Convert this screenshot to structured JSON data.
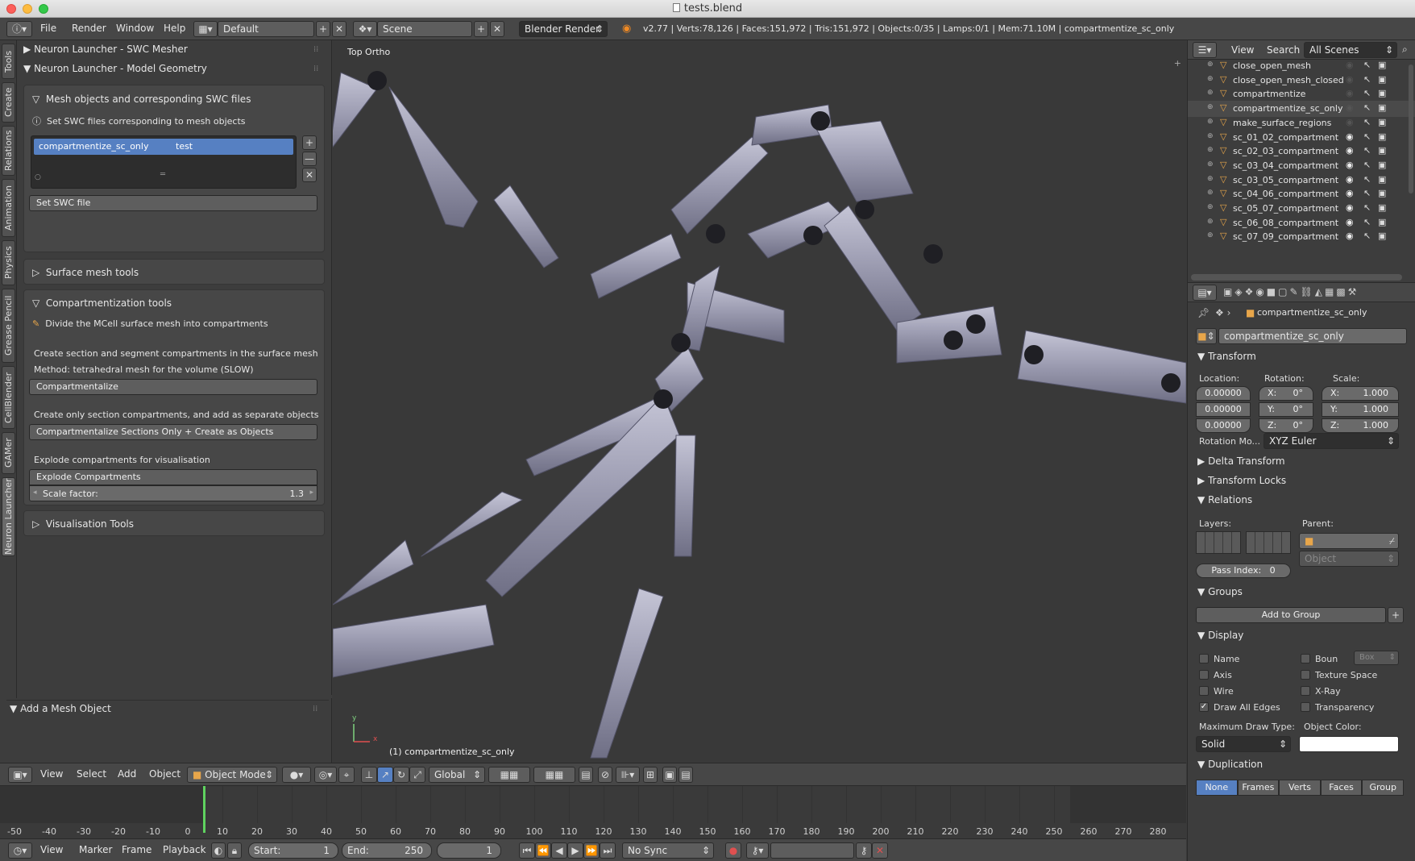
{
  "window": {
    "title": "tests.blend"
  },
  "infobar": {
    "menus": [
      "File",
      "Render",
      "Window",
      "Help"
    ],
    "layout": "Default",
    "scene": "Scene",
    "engine": "Blender Render",
    "stats": "v2.77 | Verts:78,126 | Faces:151,972 | Tris:151,972 | Objects:0/35 | Lamps:0/1 | Mem:71.10M | compartmentize_sc_only"
  },
  "vtabs": [
    "Tools",
    "Create",
    "Relations",
    "Animation",
    "Physics",
    "Grease Pencil",
    "CellBlender",
    "GAMer",
    "Neuron Launcher"
  ],
  "toolshelf": {
    "panel1": "Neuron Launcher - SWC Mesher",
    "panel2": "Neuron Launcher - Model Geometry",
    "mesh_section": "Mesh objects and corresponding SWC files",
    "set_swc_hint": "Set SWC files corresponding to mesh objects",
    "list_item_name": "compartmentize_sc_only",
    "list_item_value": "test",
    "set_swc_button": "Set SWC file",
    "surface_tools": "Surface mesh tools",
    "comp_tools": "Compartmentization tools",
    "comp_hint": "Divide the MCell surface mesh into compartments",
    "comp_text1": "Create section and segment compartments in the surface mesh",
    "comp_text2": "Method: tetrahedral mesh for the volume (SLOW)",
    "compartmentalize_button": "Compartmentalize",
    "comp_text3": "Create only section compartments, and add as separate objects",
    "sections_button": "Compartmentalize Sections Only + Create as Objects",
    "explode_text": "Explode compartments for visualisation",
    "explode_button": "Explode Compartments",
    "scale_label": "Scale factor:",
    "scale_value": "1.3",
    "vis_tools": "Visualisation Tools",
    "operator_panel": "Add a Mesh Object"
  },
  "viewport": {
    "view_name": "Top Ortho",
    "object_label": "(1) compartmentize_sc_only",
    "axis_y": "y",
    "axis_x": "x"
  },
  "viewport_header": {
    "menus": [
      "View",
      "Select",
      "Add",
      "Object"
    ],
    "mode": "Object Mode",
    "orientation": "Global"
  },
  "timeline": {
    "ticks": [
      "-50",
      "-40",
      "-30",
      "-20",
      "-10",
      "0",
      "10",
      "20",
      "30",
      "40",
      "50",
      "60",
      "70",
      "80",
      "90",
      "100",
      "110",
      "120",
      "130",
      "140",
      "150",
      "160",
      "170",
      "180",
      "190",
      "200",
      "210",
      "220",
      "230",
      "240",
      "250",
      "260",
      "270",
      "280"
    ],
    "menus": [
      "View",
      "Marker",
      "Frame",
      "Playback"
    ],
    "start_label": "Start:",
    "start_value": "1",
    "end_label": "End:",
    "end_value": "250",
    "current_frame": "1",
    "sync": "No Sync"
  },
  "outliner": {
    "menus": [
      "View",
      "Search"
    ],
    "filter": "All Scenes",
    "items": [
      {
        "name": "close_open_mesh",
        "visible": false
      },
      {
        "name": "close_open_mesh_closed",
        "visible": false
      },
      {
        "name": "compartmentize",
        "visible": false
      },
      {
        "name": "compartmentize_sc_only",
        "visible": false
      },
      {
        "name": "make_surface_regions",
        "visible": false
      },
      {
        "name": "sc_01_02_compartment",
        "visible": true
      },
      {
        "name": "sc_02_03_compartment",
        "visible": true
      },
      {
        "name": "sc_03_04_compartment",
        "visible": true
      },
      {
        "name": "sc_03_05_compartment",
        "visible": true
      },
      {
        "name": "sc_04_06_compartment",
        "visible": true
      },
      {
        "name": "sc_05_07_compartment",
        "visible": true
      },
      {
        "name": "sc_06_08_compartment",
        "visible": true
      },
      {
        "name": "sc_07_09_compartment",
        "visible": true
      }
    ]
  },
  "properties": {
    "breadcrumb": "compartmentize_sc_only",
    "object_name": "compartmentize_sc_only",
    "transform": "Transform",
    "location_label": "Location:",
    "rotation_label": "Rotation:",
    "scale_label": "Scale:",
    "location": [
      "0.00000",
      "0.00000",
      "0.00000"
    ],
    "rotation": [
      {
        "axis": "X:",
        "value": "0°"
      },
      {
        "axis": "Y:",
        "value": "0°"
      },
      {
        "axis": "Z:",
        "value": "0°"
      }
    ],
    "scale": [
      {
        "axis": "X:",
        "value": "1.000"
      },
      {
        "axis": "Y:",
        "value": "1.000"
      },
      {
        "axis": "Z:",
        "value": "1.000"
      }
    ],
    "rotation_mode_label": "Rotation Mo...",
    "rotation_mode": "XYZ Euler",
    "delta_transform": "Delta Transform",
    "transform_locks": "Transform Locks",
    "relations": "Relations",
    "layers_label": "Layers:",
    "parent_label": "Parent:",
    "parent_type": "Object",
    "pass_index_label": "Pass Index:",
    "pass_index": "0",
    "groups": "Groups",
    "add_to_group": "Add to Group",
    "display": "Display",
    "display_options": {
      "name": "Name",
      "axis": "Axis",
      "wire": "Wire",
      "draw_all_edges": "Draw All Edges",
      "bounds": "Boun",
      "bounds_type": "Box",
      "texture_space": "Texture Space",
      "xray": "X-Ray",
      "transparency": "Transparency"
    },
    "max_draw_type_label": "Maximum Draw Type:",
    "max_draw_type": "Solid",
    "object_color_label": "Object Color:",
    "duplication": "Duplication",
    "dup_options": [
      "None",
      "Frames",
      "Verts",
      "Faces",
      "Group"
    ]
  }
}
